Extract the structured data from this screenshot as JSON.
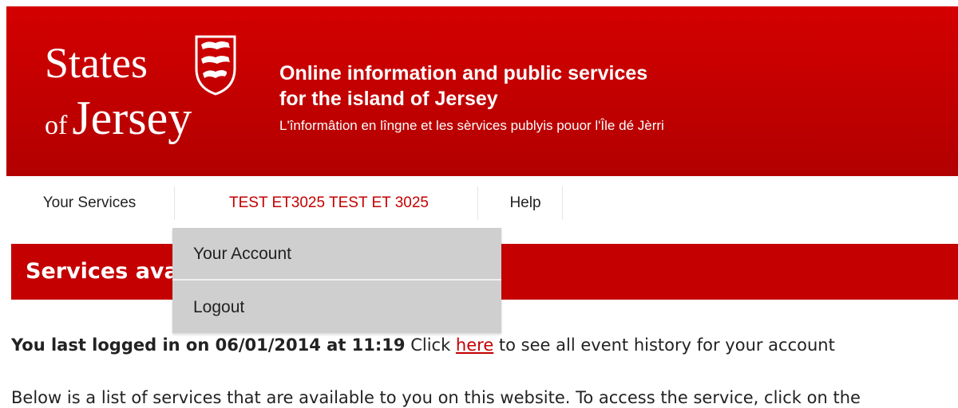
{
  "branding": {
    "logo_line1": "States",
    "logo_of": "of",
    "logo_jersey": "Jersey",
    "crest_icon": "jersey-crest-icon",
    "tagline_line1": "Online information and public services",
    "tagline_line2": "for the island of Jersey",
    "tagline_jerriais": "L'înformâtion en lîngne et les sèrvices publyis pouor l'Île dé Jèrri",
    "brand_color": "#c40000"
  },
  "nav": {
    "items": [
      {
        "label": "Your Services"
      },
      {
        "label": "TEST ET3025 TEST ET 3025"
      },
      {
        "label": "Help"
      }
    ]
  },
  "dropdown": {
    "items": [
      {
        "label": "Your Account"
      },
      {
        "label": "Logout"
      }
    ]
  },
  "main": {
    "section_title": "Services available to you",
    "last_login_label": "You last logged in on 06/01/2014 at 11:19",
    "click_text": " Click ",
    "history_link": "here",
    "history_suffix": " to see all event history for your account",
    "intro": "Below is a list of services that are available to you on this website. To access the service, click on the"
  }
}
